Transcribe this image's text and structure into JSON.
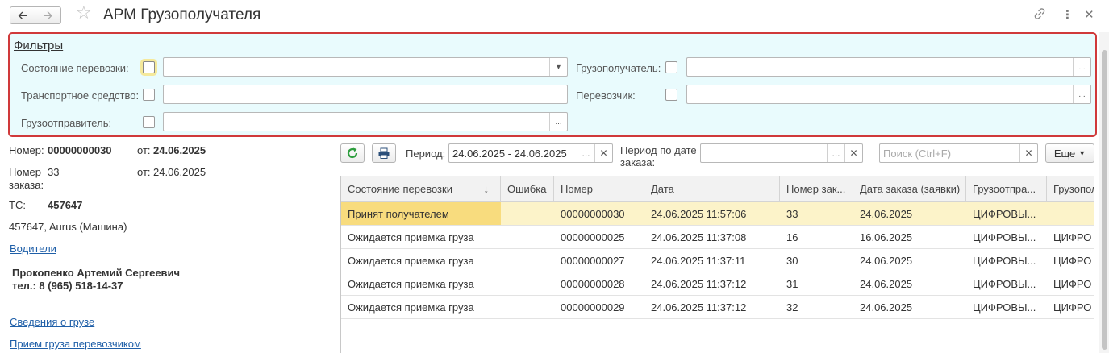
{
  "header": {
    "title": "АРМ Грузополучателя"
  },
  "filters": {
    "title": "Фильтры",
    "state_label": "Состояние перевозки:",
    "state_value": "",
    "vehicle_label": "Транспортное средство:",
    "vehicle_value": "",
    "shipper_label": "Грузоотправитель:",
    "shipper_value": "",
    "consignee_label": "Грузополучатель:",
    "consignee_value": "",
    "carrier_label": "Перевозчик:",
    "carrier_value": ""
  },
  "details": {
    "number_label": "Номер:",
    "number_value": "00000000030",
    "from_label_1": "от:",
    "from_value_1": "24.06.2025",
    "order_number_label": "Номер заказа:",
    "order_number_value": "33",
    "from_label_2": "от:",
    "from_value_2": "24.06.2025",
    "vehicle_label": "ТС:",
    "vehicle_value": "457647",
    "vehicle_desc": "457647, Aurus (Машина)",
    "drivers_link": "Водители",
    "driver_name": "Прокопенко Артемий Сергеевич",
    "driver_phone": "тел.: 8 (965) 518-14-37",
    "cargo_link": "Сведения о грузе",
    "accept_link": "Прием груза перевозчиком"
  },
  "toolbar": {
    "period_label": "Период:",
    "period_value": "24.06.2025 - 24.06.2025",
    "order_period_label_1": "Период по дате",
    "order_period_label_2": "заказа:",
    "order_period_value": "",
    "search_placeholder": "Поиск (Ctrl+F)",
    "more_label": "Еще"
  },
  "table": {
    "columns": [
      "Состояние перевозки",
      "Ошибка",
      "Номер",
      "Дата",
      "Номер зак...",
      "Дата заказа (заявки)",
      "Грузоотпра...",
      "Грузополу..."
    ],
    "rows": [
      [
        "Принят получателем",
        "",
        "00000000030",
        "24.06.2025 11:57:06",
        "33",
        "24.06.2025",
        "ЦИФРОВЫ...",
        ""
      ],
      [
        "Ожидается приемка груза",
        "",
        "00000000025",
        "24.06.2025 11:37:08",
        "16",
        "16.06.2025",
        "ЦИФРОВЫ...",
        "ЦИФРО"
      ],
      [
        "Ожидается приемка груза",
        "",
        "00000000027",
        "24.06.2025 11:37:11",
        "30",
        "24.06.2025",
        "ЦИФРОВЫ...",
        "ЦИФРО"
      ],
      [
        "Ожидается приемка груза",
        "",
        "00000000028",
        "24.06.2025 11:37:12",
        "31",
        "24.06.2025",
        "ЦИФРОВЫ...",
        "ЦИФРО"
      ],
      [
        "Ожидается приемка груза",
        "",
        "00000000029",
        "24.06.2025 11:37:12",
        "32",
        "24.06.2025",
        "ЦИФРОВЫ...",
        "ЦИФРО"
      ]
    ],
    "selected_row": 0
  },
  "colors": {
    "filter_bg": "#e9fbfd",
    "filter_border": "#d0393a",
    "selected_row": "#fcf3c9",
    "selected_cell": "#f8dc7e",
    "link": "#1f5fa8"
  }
}
